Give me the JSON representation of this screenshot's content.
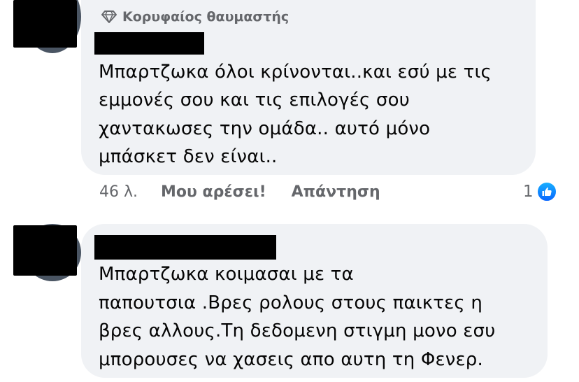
{
  "comments": [
    {
      "badge": {
        "icon": "diamond-icon",
        "label": "Κορυφαίος θαυμαστής"
      },
      "lines": [
        "Μπαρτζωκα όλοι κρίνονται..και εσύ με τις",
        "εμμονές σου και τις επιλογές σου",
        "χαντακωσες την ομάδα.. αυτό μόνο",
        "μπάσκετ δεν είναι.."
      ],
      "meta": {
        "time": "46 λ.",
        "like_label": "Μου αρέσει!",
        "reply_label": "Απάντηση",
        "reaction_count": "1",
        "reaction_icon": "like-icon"
      }
    },
    {
      "lines": [
        "Μπαρτζωκα κοιμασαι με τα",
        "παπουτσια .Βρες ρολους στους παικτες η",
        "βρες αλλους.Τη δεδομενη στιγμη μονο εσυ",
        "μπορουσες να χασεις απο αυτη τη Φενερ."
      ]
    }
  ],
  "colors": {
    "bubble": "#f0f2f5",
    "text": "#050505",
    "secondary_text": "#65676b",
    "like_blue": "#0866ff"
  }
}
